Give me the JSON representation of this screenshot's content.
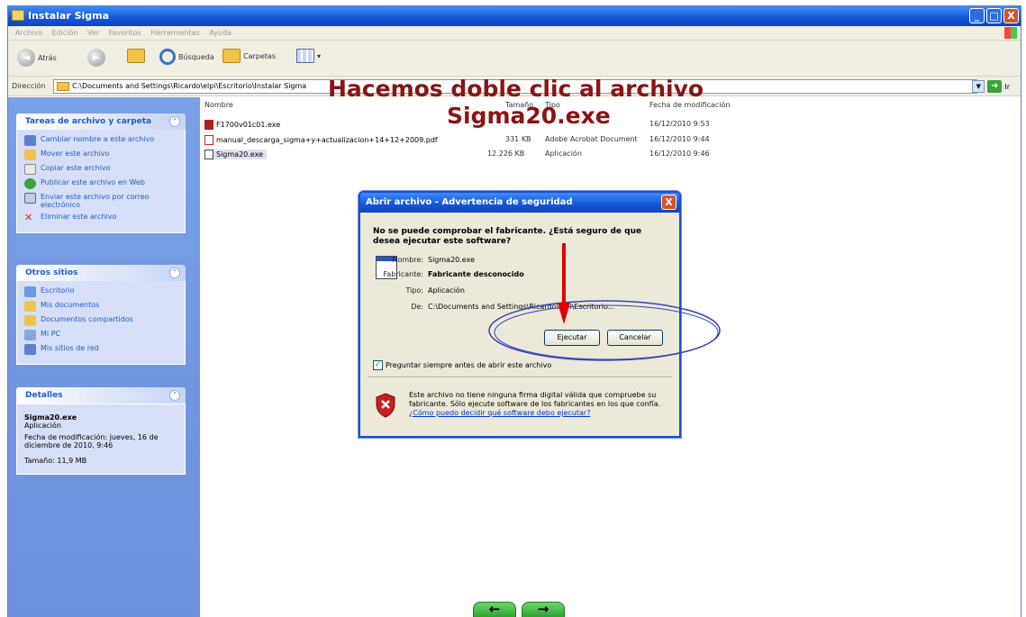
{
  "window": {
    "title": "Instalar Sigma",
    "minimize": "_",
    "maximize": "□",
    "close": "X"
  },
  "menu": [
    "Archivo",
    "Edición",
    "Ver",
    "Favoritos",
    "Herramientas",
    "Ayuda"
  ],
  "toolbar": {
    "back_label": "Atrás",
    "search_label": "Búsqueda",
    "folders_label": "Carpetas"
  },
  "address": {
    "label": "Dirección",
    "path": "C:\\Documents and Settings\\Ricardo\\elpi\\Escritorio\\Instalar Sigma",
    "go_label": "Ir"
  },
  "tasks_panel": {
    "title": "Tareas de archivo y carpeta",
    "items": [
      "Cambiar nombre a este archivo",
      "Mover este archivo",
      "Copiar este archivo",
      "Publicar este archivo en Web",
      "Enviar este archivo por correo electrónico",
      "Eliminar este archivo"
    ]
  },
  "places_panel": {
    "title": "Otros sitios",
    "items": [
      "Escritorio",
      "Mis documentos",
      "Documentos compartidos",
      "Mi PC",
      "Mis sitios de red"
    ]
  },
  "details_panel": {
    "title": "Detalles",
    "file_name": "Sigma20.exe",
    "file_type": "Aplicación",
    "modified": "Fecha de modificación: jueves, 16 de diciembre de 2010, 9:46",
    "size": "Tamaño: 11,9 MB"
  },
  "file_list": {
    "columns": {
      "name": "Nombre",
      "size": "Tamaño",
      "type": "Tipo",
      "date": "Fecha de modificación"
    },
    "files": [
      {
        "name": "F1700v01c01.exe",
        "size": "",
        "type": "",
        "date": "16/12/2010 9:53"
      },
      {
        "name": "manual_descarga_sigma+y+actualizacion+14+12+2009.pdf",
        "size": "331 KB",
        "type": "Adobe Acrobat Document",
        "date": "16/12/2010 9:44"
      },
      {
        "name": "Sigma20.exe",
        "size": "12.226 KB",
        "type": "Aplicación",
        "date": "16/12/2010 9:46"
      }
    ]
  },
  "overlay": {
    "line1": "Hacemos doble clic al archivo",
    "line2": "Sigma20.exe"
  },
  "dialog": {
    "title": "Abrir archivo - Advertencia de seguridad",
    "close": "X",
    "question": "No se puede comprobar el fabricante. ¿Está seguro de que desea ejecutar este software?",
    "fields": {
      "name_label": "Nombre:",
      "name_value": "Sigma20.exe",
      "publisher_label": "Fabricante:",
      "publisher_value": "Fabricante desconocido",
      "type_label": "Tipo:",
      "type_value": "Aplicación",
      "from_label": "De:",
      "from_value": "C:\\Documents and Settings\\Ricardo\\elpi\\Escritorio..."
    },
    "run_button": "Ejecutar",
    "cancel_button": "Cancelar",
    "checkbox_label": "Preguntar siempre antes de abrir este archivo",
    "warning_text": "Este archivo no tiene ninguna firma digital válida que compruebe su fabricante. Sólo ejecute software de los fabricantes en los que confía.",
    "warning_link": "¿Cómo puedo decidir qué software debo ejecutar?"
  },
  "nav": {
    "prev": "←",
    "next": "→"
  },
  "colors": {
    "overlay": "#8a1414",
    "arrow": "#e00000",
    "ellipse": "#3344bb"
  }
}
